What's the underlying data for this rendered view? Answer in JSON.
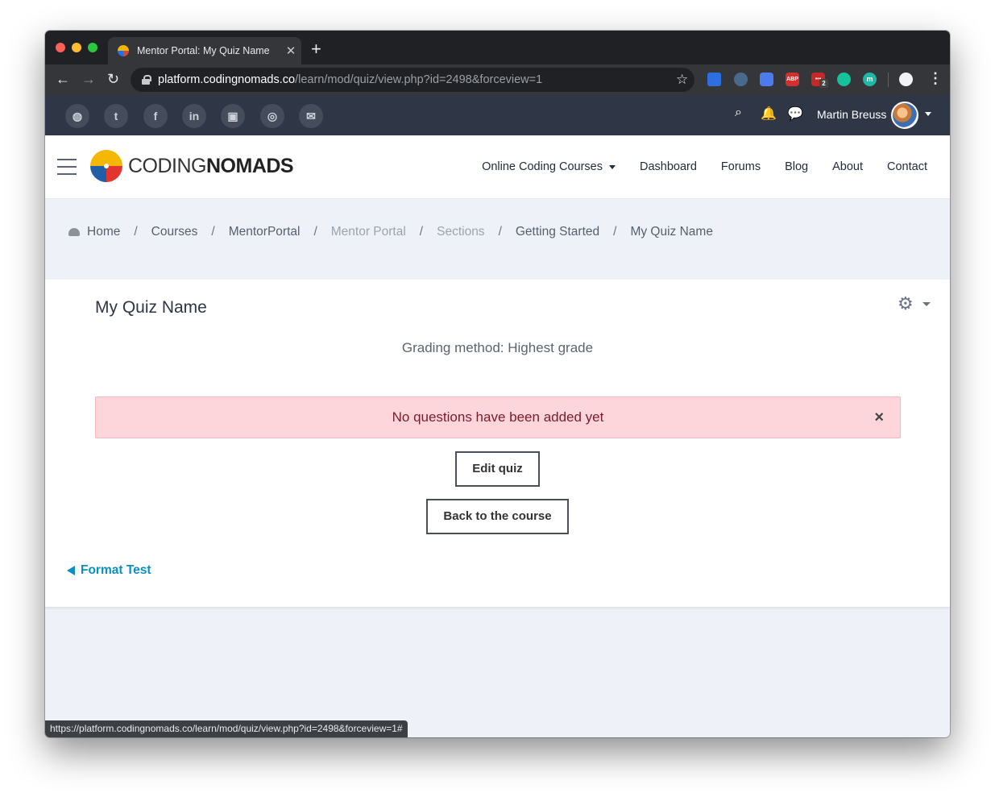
{
  "browser": {
    "tab_title": "Mentor Portal: My Quiz Name",
    "tab_close": "✕",
    "new_tab": "+",
    "url_host": "platform.codingnomads.co",
    "url_path": "/learn/mod/quiz/view.php?id=2498&forceview=1",
    "back": "←",
    "forward": "→",
    "reload": "↻",
    "bookmark": "☆",
    "extensions": [
      "",
      "",
      "",
      "ABP",
      "•••",
      "",
      "m",
      ""
    ],
    "extension_badge": "2",
    "menu": "⋮",
    "status_url": "https://platform.codingnomads.co/learn/mod/quiz/view.php?id=2498&forceview=1#"
  },
  "topbar": {
    "social": [
      "◍",
      "t",
      "f",
      "in",
      "▣",
      "◎",
      "✉"
    ],
    "search": "⌕",
    "bell": "🔔",
    "chat": "💬",
    "username": "Martin Breuss"
  },
  "header": {
    "logo_light": "CODING",
    "logo_bold": "NOMADS",
    "nav": [
      "Online Coding Courses",
      "Dashboard",
      "Forums",
      "Blog",
      "About",
      "Contact"
    ]
  },
  "breadcrumb": {
    "items": [
      "Home",
      "Courses",
      "MentorPortal",
      "Mentor Portal",
      "Sections",
      "Getting Started",
      "My Quiz Name"
    ],
    "separator": "/"
  },
  "main": {
    "title": "My Quiz Name",
    "gear": "⚙",
    "grading": "Grading method: Highest grade",
    "alert": "No questions have been added yet",
    "alert_close": "×",
    "edit_button": "Edit quiz",
    "back_button": "Back to the course",
    "prev_link": "Format Test"
  },
  "colors": {
    "accent_link": "#0c8fc4",
    "alert_bg": "#fdd6db",
    "topbar_bg": "#2f3747"
  }
}
